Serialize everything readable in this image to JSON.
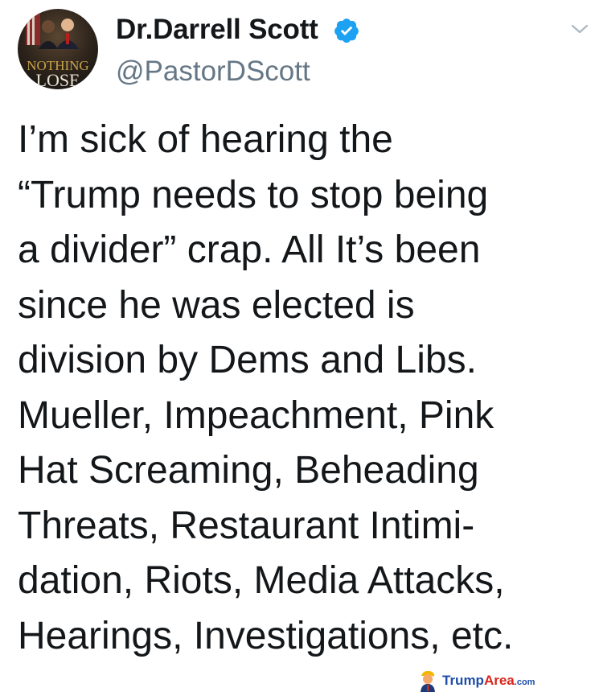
{
  "author": {
    "display_name": "Dr.Darrell Scott",
    "handle": "@PastorDScott",
    "verified_icon": "verified-badge-icon",
    "avatar_text_lines": [
      "NOTHING",
      "LOSE"
    ]
  },
  "menu": {
    "icon": "chevron-down-icon"
  },
  "tweet": {
    "lines": [
      "I’m sick of hearing the",
      "“Trump needs to stop being",
      "a divider” crap. All It’s been",
      "since he was elected is",
      "division by Dems and Libs.",
      "Mueller, Impeachment, Pink",
      "Hat Screaming, Beheading",
      "Threats, Restaurant Intimi-",
      "dation, Riots, Media Attacks,",
      "Hearings, Investigations, etc."
    ]
  },
  "watermark": {
    "part1": "Trump",
    "part2": "Area",
    "part3": ".com",
    "logo_icon": "trump-caricature-icon"
  },
  "colors": {
    "text": "#14171a",
    "secondary": "#657786",
    "verified": "#1da1f2",
    "watermark_blue": "#1f4ea8",
    "watermark_red": "#d9241c"
  }
}
